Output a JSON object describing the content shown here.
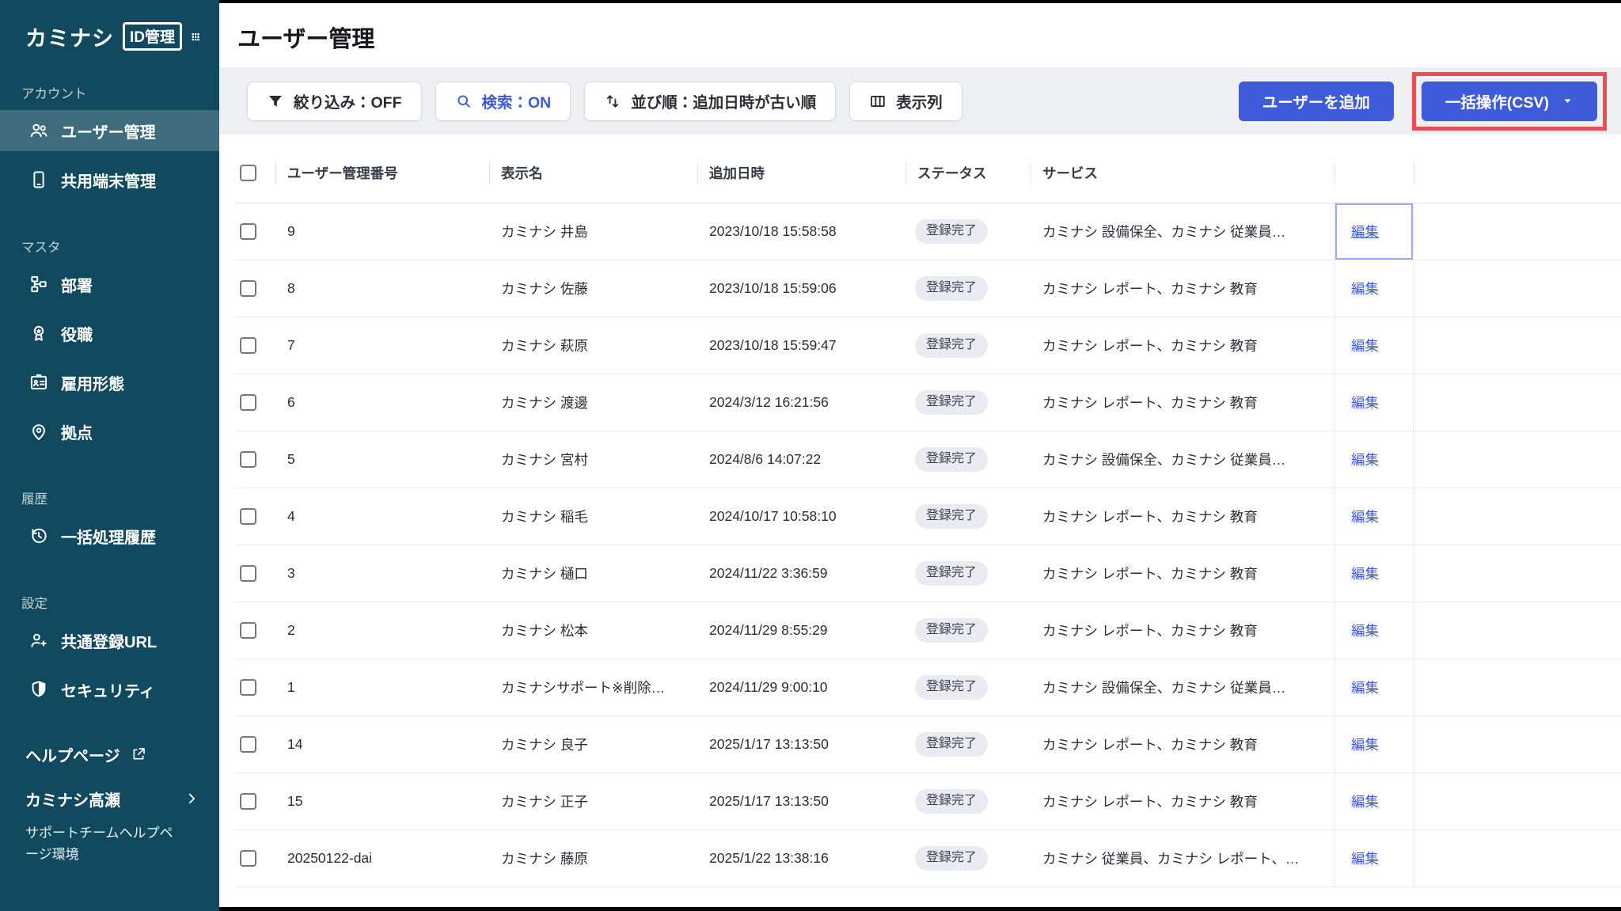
{
  "app": {
    "brand": "カミナシ",
    "badge": "ID管理",
    "apps_icon": "apps-grid-icon"
  },
  "colors": {
    "sidebar_bg": "#114a5e",
    "accent_blue": "#3e5bd9",
    "annotation_red": "#ea4e52",
    "toolbar_bg": "#eeeff2",
    "badge_bg": "#e9eaf2",
    "edit_focus_ring": "#9aacee"
  },
  "sidebar": {
    "sections": [
      {
        "label": "アカウント",
        "items": [
          {
            "id": "user-management",
            "label": "ユーザー管理",
            "icon": "users-icon",
            "active": true
          },
          {
            "id": "shared-device-management",
            "label": "共用端末管理",
            "icon": "tablet-icon",
            "active": false
          }
        ]
      },
      {
        "label": "マスタ",
        "items": [
          {
            "id": "department",
            "label": "部署",
            "icon": "org-chart-icon",
            "active": false
          },
          {
            "id": "position",
            "label": "役職",
            "icon": "medal-icon",
            "active": false
          },
          {
            "id": "employment-type",
            "label": "雇用形態",
            "icon": "id-card-icon",
            "active": false
          },
          {
            "id": "location",
            "label": "拠点",
            "icon": "location-pin-icon",
            "active": false
          }
        ]
      },
      {
        "label": "履歴",
        "items": [
          {
            "id": "bulk-process-history",
            "label": "一括処理履歴",
            "icon": "history-icon",
            "active": false
          }
        ]
      },
      {
        "label": "設定",
        "items": [
          {
            "id": "common-registration-url",
            "label": "共通登録URL",
            "icon": "user-add-icon",
            "active": false
          },
          {
            "id": "security",
            "label": "セキュリティ",
            "icon": "shield-icon",
            "active": false
          }
        ]
      }
    ],
    "footer": {
      "help_label": "ヘルプページ",
      "help_icon": "external-link-icon",
      "account_name": "カミナシ高瀬",
      "account_icon": "chevron-right-icon",
      "env_note": "サポートチームヘルプページ環境"
    }
  },
  "header": {
    "title": "ユーザー管理"
  },
  "toolbar": {
    "filter": {
      "label": "絞り込み：OFF",
      "icon": "filter-icon"
    },
    "search": {
      "label": "検索：ON",
      "icon": "search-icon"
    },
    "sort": {
      "label": "並び順：追加日時が古い順",
      "icon": "sort-icon"
    },
    "columns": {
      "label": "表示列",
      "icon": "columns-icon"
    },
    "add_user_label": "ユーザーを追加",
    "bulk_label": "一括操作(CSV)",
    "bulk_caret_icon": "caret-down-icon"
  },
  "table": {
    "headers": [
      "ユーザー管理番号",
      "表示名",
      "追加日時",
      "ステータス",
      "サービス"
    ],
    "edit_label": "編集",
    "rows": [
      {
        "user_id": "9",
        "display_name": "カミナシ 井島",
        "added_at": "2023/10/18 15:58:58",
        "status": "登録完了",
        "services": "カミナシ 設備保全、カミナシ 従業員…",
        "edit_focused": true
      },
      {
        "user_id": "8",
        "display_name": "カミナシ 佐藤",
        "added_at": "2023/10/18 15:59:06",
        "status": "登録完了",
        "services": "カミナシ レポート、カミナシ 教育",
        "edit_focused": false
      },
      {
        "user_id": "7",
        "display_name": "カミナシ 萩原",
        "added_at": "2023/10/18 15:59:47",
        "status": "登録完了",
        "services": "カミナシ レポート、カミナシ 教育",
        "edit_focused": false
      },
      {
        "user_id": "6",
        "display_name": "カミナシ 渡邊",
        "added_at": "2024/3/12 16:21:56",
        "status": "登録完了",
        "services": "カミナシ レポート、カミナシ 教育",
        "edit_focused": false
      },
      {
        "user_id": "5",
        "display_name": "カミナシ 宮村",
        "added_at": "2024/8/6 14:07:22",
        "status": "登録完了",
        "services": "カミナシ 設備保全、カミナシ 従業員…",
        "edit_focused": false
      },
      {
        "user_id": "4",
        "display_name": "カミナシ 稲毛",
        "added_at": "2024/10/17 10:58:10",
        "status": "登録完了",
        "services": "カミナシ レポート、カミナシ 教育",
        "edit_focused": false
      },
      {
        "user_id": "3",
        "display_name": "カミナシ 樋口",
        "added_at": "2024/11/22 3:36:59",
        "status": "登録完了",
        "services": "カミナシ レポート、カミナシ 教育",
        "edit_focused": false
      },
      {
        "user_id": "2",
        "display_name": "カミナシ 松本",
        "added_at": "2024/11/29 8:55:29",
        "status": "登録完了",
        "services": "カミナシ レポート、カミナシ 教育",
        "edit_focused": false
      },
      {
        "user_id": "1",
        "display_name": "カミナシサポート※削除…",
        "added_at": "2024/11/29 9:00:10",
        "status": "登録完了",
        "services": "カミナシ 設備保全、カミナシ 従業員…",
        "edit_focused": false
      },
      {
        "user_id": "14",
        "display_name": "カミナシ 良子",
        "added_at": "2025/1/17 13:13:50",
        "status": "登録完了",
        "services": "カミナシ レポート、カミナシ 教育",
        "edit_focused": false
      },
      {
        "user_id": "15",
        "display_name": "カミナシ 正子",
        "added_at": "2025/1/17 13:13:50",
        "status": "登録完了",
        "services": "カミナシ レポート、カミナシ 教育",
        "edit_focused": false
      },
      {
        "user_id": "20250122-dai",
        "display_name": "カミナシ 藤原",
        "added_at": "2025/1/22 13:38:16",
        "status": "登録完了",
        "services": "カミナシ 従業員、カミナシ レポート、…",
        "edit_focused": false
      }
    ]
  }
}
